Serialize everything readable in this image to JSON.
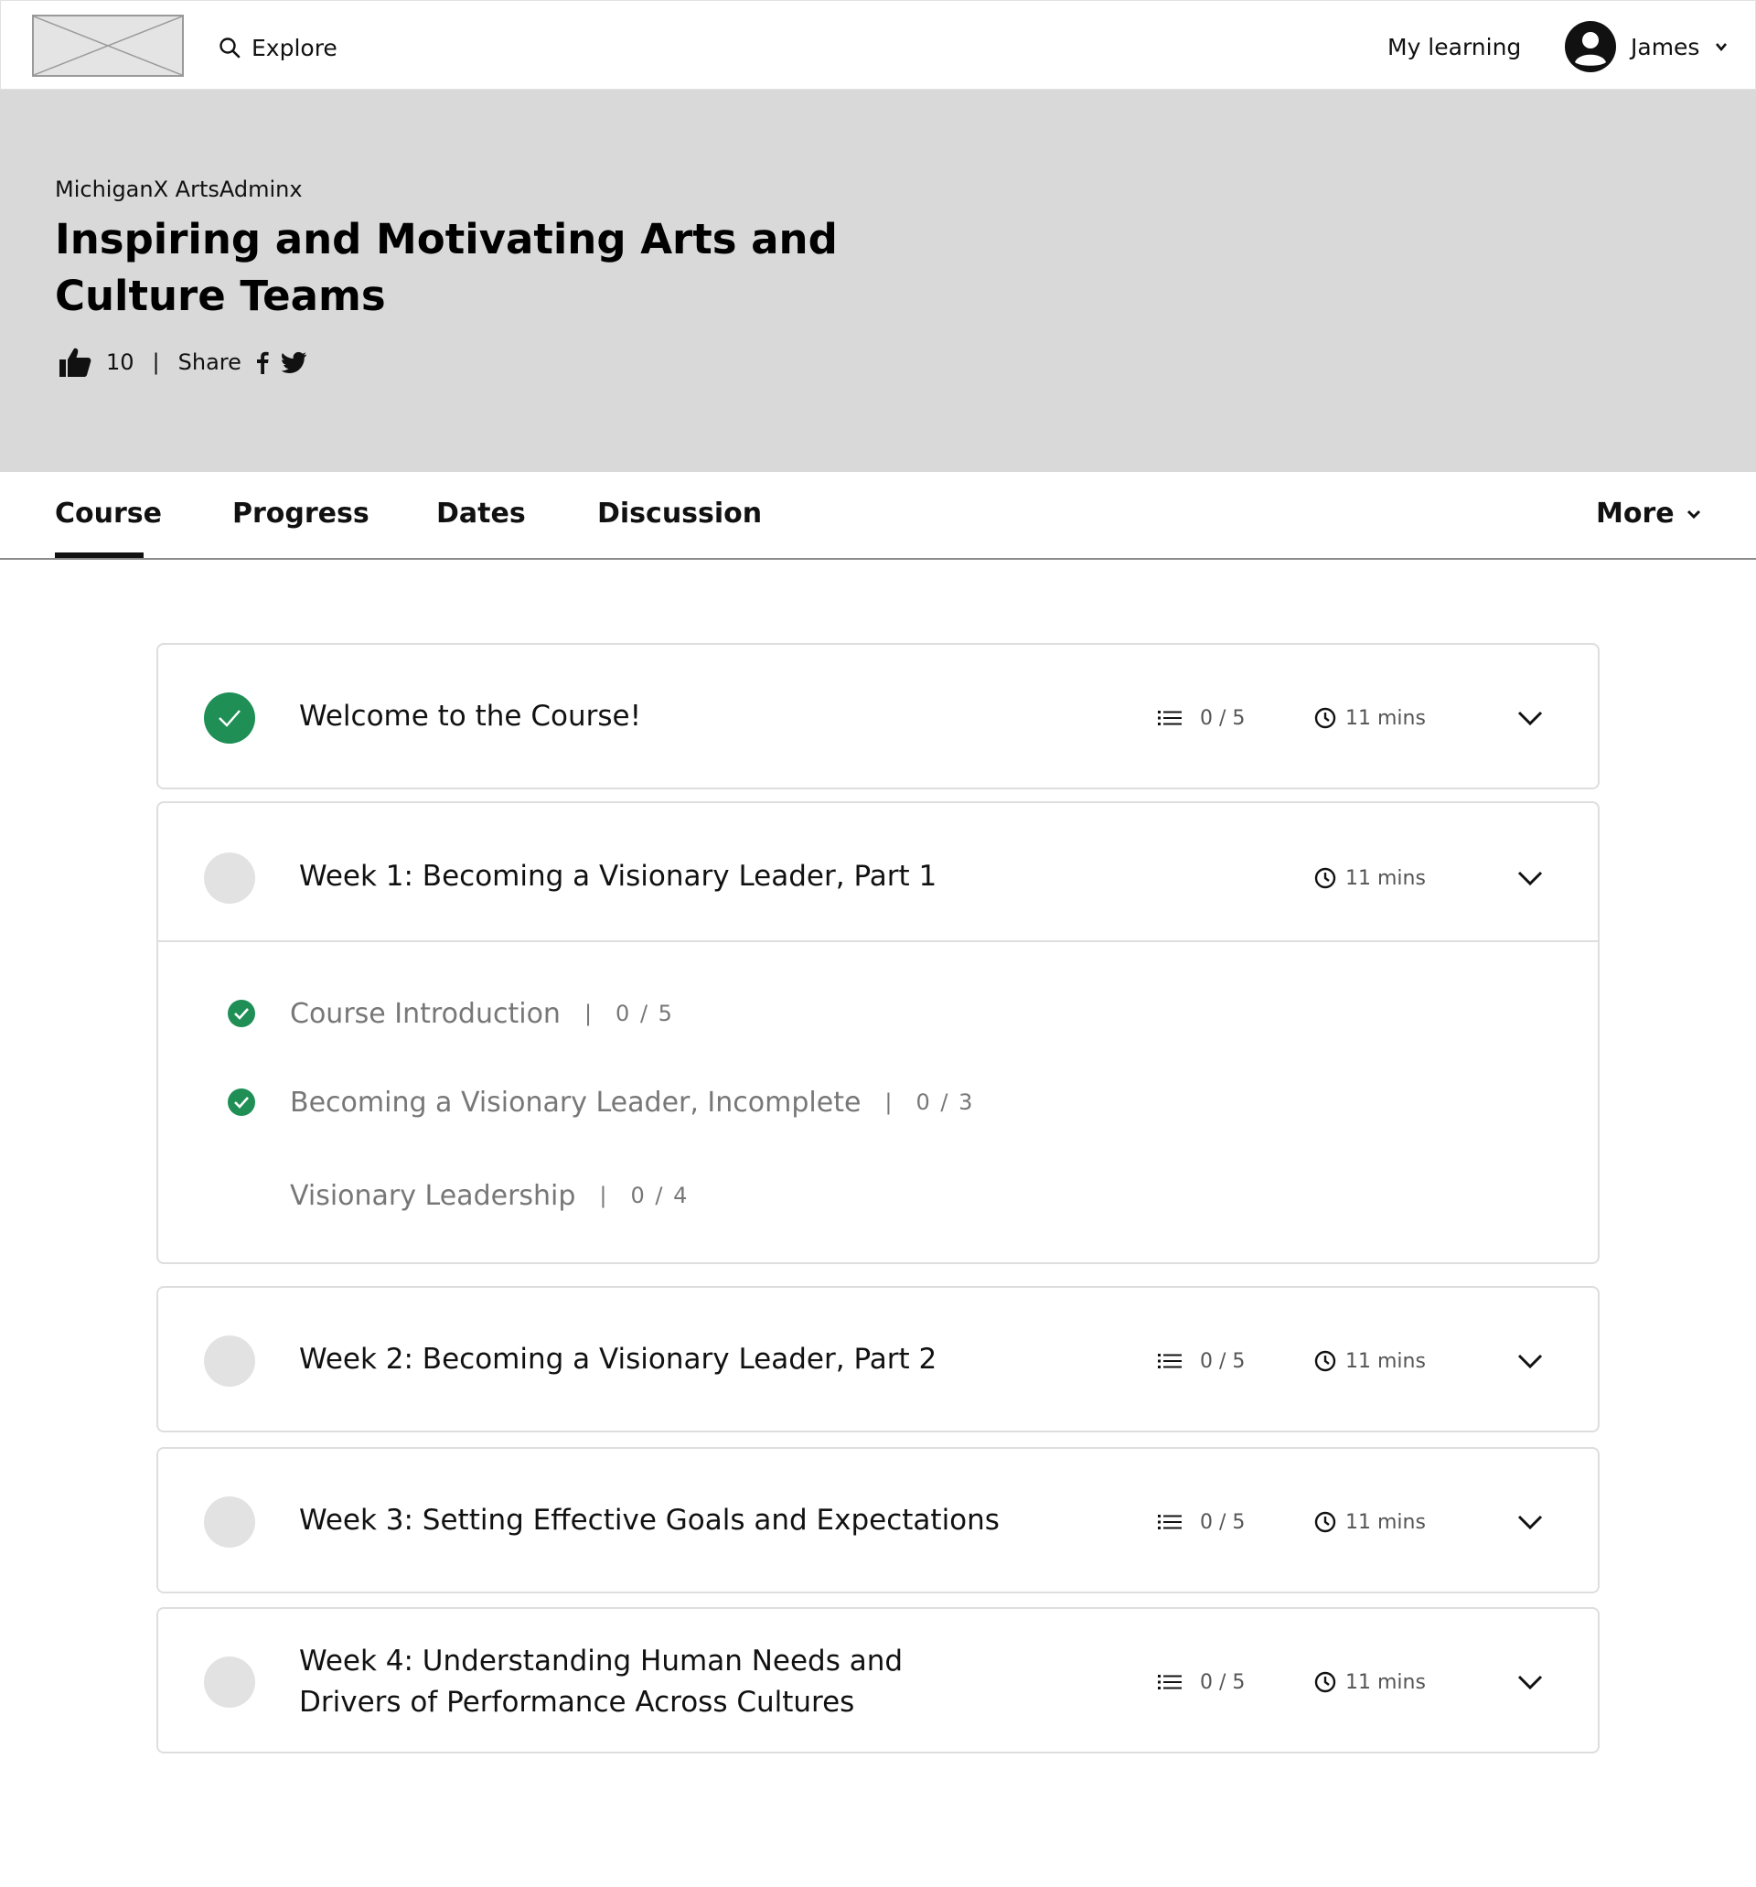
{
  "nav": {
    "explore_label": "Explore",
    "my_learning_label": "My learning",
    "user_name": "James"
  },
  "hero": {
    "org": "MichiganX ArtsAdminx",
    "title": "Inspiring and Motivating Arts and Culture Teams",
    "likes": "10",
    "separator": "|",
    "share_label": "Share"
  },
  "tabs": {
    "items": [
      {
        "label": "Course",
        "active": true
      },
      {
        "label": "Progress",
        "active": false
      },
      {
        "label": "Dates",
        "active": false
      },
      {
        "label": "Discussion",
        "active": false
      }
    ],
    "more_label": "More"
  },
  "colors": {
    "accent_green": "#1f8f56",
    "hero_bg": "#d9d9d9",
    "pending_circle": "#e2e2e2"
  },
  "sections": [
    {
      "title": "Welcome to the Course!",
      "status": "complete",
      "lessons": "0 / 5",
      "duration": "11 mins"
    },
    {
      "title": "Week 1: Becoming a Visionary Leader, Part 1",
      "status": "incomplete",
      "duration": "11 mins",
      "expanded": true,
      "subsections": [
        {
          "title": "Course Introduction",
          "complete": true,
          "separator": "|",
          "count": "0 / 5"
        },
        {
          "title": "Becoming a Visionary Leader, Incomplete",
          "complete": true,
          "separator": "|",
          "count": "0 / 3"
        },
        {
          "title": "Visionary Leadership",
          "complete": false,
          "separator": "|",
          "count": "0 / 4"
        }
      ]
    },
    {
      "title": "Week 2: Becoming a Visionary Leader, Part 2",
      "status": "incomplete",
      "lessons": "0 / 5",
      "duration": "11 mins"
    },
    {
      "title": "Week 3: Setting Effective Goals and Expectations",
      "status": "incomplete",
      "lessons": "0 / 5",
      "duration": "11 mins"
    },
    {
      "title_line1": "Week 4: Understanding Human Needs and",
      "title_line2": "Drivers of Performance Across Cultures",
      "status": "incomplete",
      "lessons": "0 / 5",
      "duration": "11 mins"
    }
  ]
}
